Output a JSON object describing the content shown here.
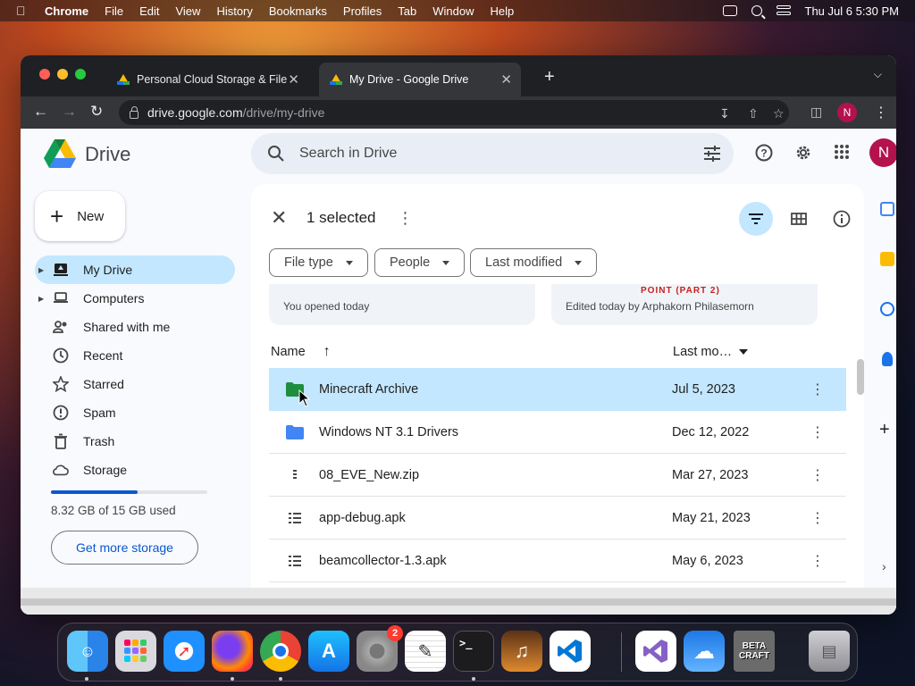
{
  "menubar": {
    "app": "Chrome",
    "items": [
      "File",
      "Edit",
      "View",
      "History",
      "Bookmarks",
      "Profiles",
      "Tab",
      "Window",
      "Help"
    ],
    "clock": "Thu Jul 6  5:30 PM"
  },
  "browser": {
    "tabs": [
      {
        "title": "Personal Cloud Storage & File S",
        "active": false
      },
      {
        "title": "My Drive - Google Drive",
        "active": true
      }
    ],
    "url_host": "drive.google.com",
    "url_path": "/drive/my-drive",
    "profile_initial": "N"
  },
  "drive": {
    "app_name": "Drive",
    "search_placeholder": "Search in Drive",
    "avatar_initial": "N",
    "new_button": "New",
    "sidebar": [
      {
        "label": "My Drive",
        "icon": "my-drive-icon",
        "active": true,
        "expandable": true
      },
      {
        "label": "Computers",
        "icon": "computers-icon",
        "active": false,
        "expandable": true
      },
      {
        "label": "Shared with me",
        "icon": "shared-icon",
        "active": false,
        "expandable": false
      },
      {
        "label": "Recent",
        "icon": "clock-icon",
        "active": false,
        "expandable": false
      },
      {
        "label": "Starred",
        "icon": "star-icon",
        "active": false,
        "expandable": false
      },
      {
        "label": "Spam",
        "icon": "spam-icon",
        "active": false,
        "expandable": false
      },
      {
        "label": "Trash",
        "icon": "trash-icon",
        "active": false,
        "expandable": false
      },
      {
        "label": "Storage",
        "icon": "cloud-icon",
        "active": false,
        "expandable": false
      }
    ],
    "storage": {
      "used_text": "8.32 GB of 15 GB used",
      "fraction": 0.555
    },
    "get_more_storage": "Get more storage",
    "selection": {
      "count_text": "1 selected"
    },
    "filters": [
      "File type",
      "People",
      "Last modified"
    ],
    "suggested_cards": [
      {
        "subtitle": "You opened today",
        "peek": ""
      },
      {
        "subtitle": "Edited today by Arphakorn Philasemorn",
        "peek": "POINT (PART 2)"
      }
    ],
    "columns": {
      "name": "Name",
      "modified": "Last mo…"
    },
    "files": [
      {
        "name": "Minecraft Archive",
        "date": "Jul 5, 2023",
        "type": "folder-green",
        "selected": true
      },
      {
        "name": "Windows NT 3.1 Drivers",
        "date": "Dec 12, 2022",
        "type": "folder-blue",
        "selected": false
      },
      {
        "name": "08_EVE_New.zip",
        "date": "Mar 27, 2023",
        "type": "zip",
        "selected": false
      },
      {
        "name": "app-debug.apk",
        "date": "May 21, 2023",
        "type": "apk",
        "selected": false
      },
      {
        "name": "beamcollector-1.3.apk",
        "date": "May 6, 2023",
        "type": "apk",
        "selected": false
      }
    ]
  },
  "dock": {
    "apps": [
      "Finder",
      "Launchpad",
      "Safari",
      "Firefox",
      "Chrome",
      "App Store",
      "System Settings",
      "TextEdit",
      "Terminal",
      "GarageBand",
      "Visual Studio Code",
      "Visual Studio",
      "Weather",
      "Beta Craft",
      "Trash"
    ],
    "settings_badge": "2",
    "betacraft_label": "BETA CRAFT"
  },
  "colors": {
    "accent": "#0b57d0",
    "selected_bg": "#c2e7ff",
    "avatar": "#b3124c",
    "folder_green": "#1e8e3e",
    "folder_blue": "#4285f4"
  }
}
